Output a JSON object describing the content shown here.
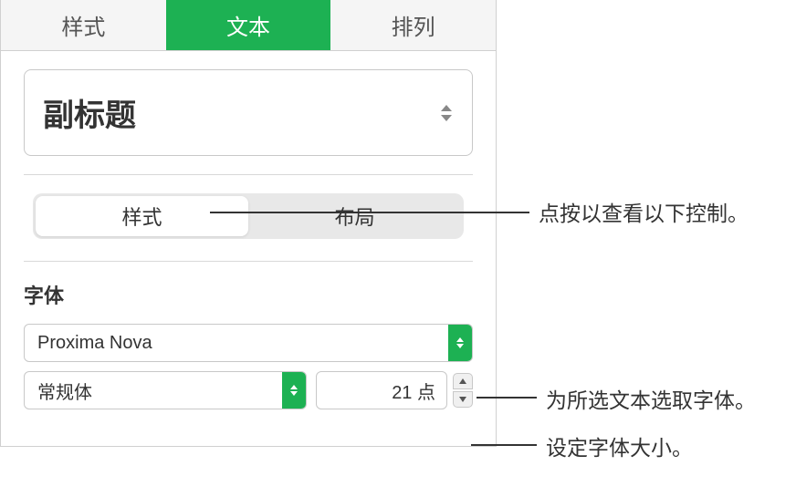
{
  "tabs": {
    "style": "样式",
    "text": "文本",
    "arrange": "排列"
  },
  "paragraph_style": {
    "current": "副标题"
  },
  "subtabs": {
    "style": "样式",
    "layout": "布局"
  },
  "font_section": {
    "label": "字体",
    "family": "Proxima Nova",
    "weight": "常规体",
    "size_value": "21",
    "size_unit": "点"
  },
  "callouts": {
    "subtab": "点按以查看以下控制。",
    "font_family": "为所选文本选取字体。",
    "font_size": "设定字体大小。"
  }
}
